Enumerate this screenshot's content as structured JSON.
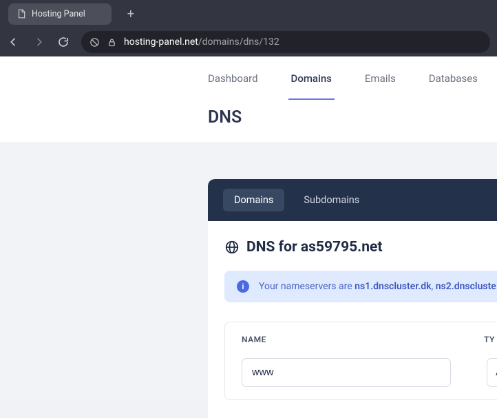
{
  "browser": {
    "tab_title": "Hosting Panel",
    "url_host": "hosting-panel.net",
    "url_path": "/domains/dns/132"
  },
  "topnav": {
    "items": [
      "Dashboard",
      "Domains",
      "Emails",
      "Databases"
    ],
    "active_index": 1
  },
  "page": {
    "title": "DNS"
  },
  "panel": {
    "tabs": [
      "Domains",
      "Subdomains"
    ],
    "active_index": 0,
    "heading_prefix": "DNS for ",
    "heading_domain": "as59795.net",
    "nameserver_notice": {
      "prefix": "Your nameservers are ",
      "ns1": "ns1.dnscluster.dk",
      "sep": ", ",
      "ns2": "ns2.dnscluste"
    },
    "table": {
      "col_name": "NAME",
      "col_type": "TY"
    },
    "record_form": {
      "name_value": "www",
      "type_value": "A"
    }
  }
}
